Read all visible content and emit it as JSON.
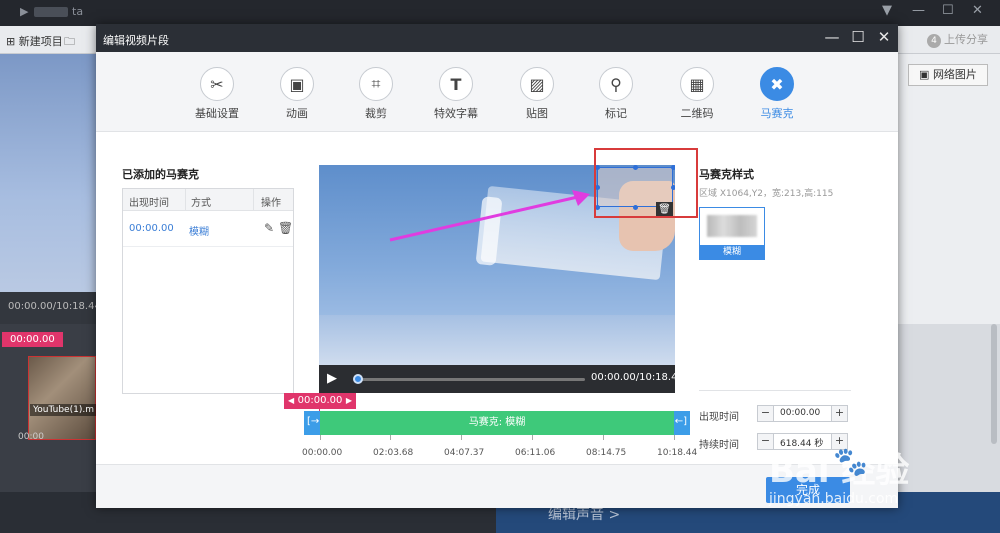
{
  "background": {
    "app_title": "ta",
    "new_project": "新建项目",
    "share_num": "4",
    "share_label": "上传分享",
    "left_time": "00:00.00/10:18.44",
    "left_track_tc": "00:00.00",
    "left_thumb_label": "YouTube(1).m",
    "left_tick": "00:00",
    "net_image": "网络图片",
    "edit_audio": "编辑声音 >"
  },
  "dialog": {
    "title": "编辑视频片段",
    "tabs": [
      {
        "label": "基础设置",
        "icon": "scissors-icon"
      },
      {
        "label": "动画",
        "icon": "animation-icon"
      },
      {
        "label": "裁剪",
        "icon": "crop-icon"
      },
      {
        "label": "特效字幕",
        "icon": "text-icon"
      },
      {
        "label": "贴图",
        "icon": "image-icon"
      },
      {
        "label": "标记",
        "icon": "pin-icon"
      },
      {
        "label": "二维码",
        "icon": "qrcode-icon"
      },
      {
        "label": "马赛克",
        "icon": "mosaic-icon",
        "active": true
      }
    ],
    "added_title": "已添加的马赛克",
    "table": {
      "headers": [
        "出现时间",
        "方式",
        "操作"
      ],
      "rows": [
        {
          "time": "00:00.00",
          "mode": "模糊"
        }
      ]
    },
    "video": {
      "time": "00:00.00/10:18.44"
    },
    "style": {
      "title": "马赛克样式",
      "region": "区域 X1064,Y2，宽:213,高:115",
      "card_label": "模糊"
    },
    "appear_label": "出现时间",
    "appear_value": "00:00.00",
    "duration_label": "持续时间",
    "duration_value": "618.44 秒",
    "marker": "00:00.00",
    "segment_label": "马赛克: 模糊",
    "ticks": [
      "00:00.00",
      "02:03.68",
      "04:07.37",
      "06:11.06",
      "08:14.75",
      "10:18.44"
    ],
    "done": "完成"
  },
  "watermark": {
    "big": "Bai  经验",
    "small": "jingyan.baidu.com"
  },
  "colors": {
    "accent": "#3b8be4",
    "segment": "#3ec97a",
    "marker": "#e0356b",
    "highlight": "#d83b3b",
    "arrow": "#e03ce0"
  }
}
